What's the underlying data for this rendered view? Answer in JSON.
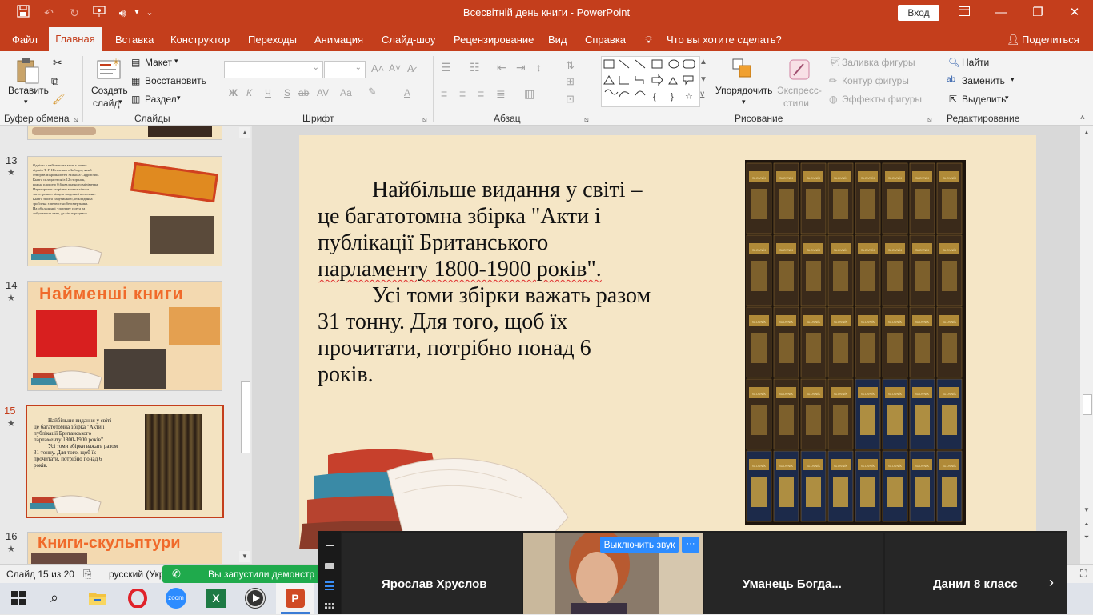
{
  "titlebar": {
    "title": "Всесвітній день книги  -  PowerPoint",
    "login": "Вход",
    "icons": [
      "save-icon",
      "undo-icon",
      "redo-icon",
      "slideshow-icon",
      "sound-icon",
      "customize-icon"
    ]
  },
  "menu": {
    "items": [
      "Файл",
      "Главная",
      "Вставка",
      "Конструктор",
      "Переходы",
      "Анимация",
      "Слайд-шоу",
      "Рецензирование",
      "Вид",
      "Справка",
      "Что вы хотите сделать?",
      "Поделиться"
    ]
  },
  "ribbon": {
    "clipboard": {
      "paste": "Вставить",
      "label": "Буфер обмена"
    },
    "slides": {
      "create_line1": "Создать",
      "create_line2": "слайд",
      "layout": "Макет",
      "reset": "Восстановить",
      "section": "Раздел",
      "label": "Слайды"
    },
    "font": {
      "label": "Шрифт",
      "buttons": [
        "Ж",
        "К",
        "Ч",
        "S",
        "ab",
        "AV",
        "Аа",
        "A"
      ]
    },
    "paragraph": {
      "label": "Абзац"
    },
    "drawing": {
      "arrange": "Упорядочить",
      "quick_line1": "Экспресс-",
      "quick_line2": "стили",
      "fill": "Заливка фигуры",
      "outline": "Контур фигуры",
      "effects": "Эффекты фигуры",
      "label": "Рисование"
    },
    "editing": {
      "find": "Найти",
      "replace": "Заменить",
      "select": "Выделить",
      "label": "Редактирование"
    }
  },
  "thumbnails": [
    {
      "num": "13",
      "star": "★",
      "lines": [
        "Однією з найменших книг є томик",
        "віршів Т. Г. Шевченка «Кобзар», який",
        "створив мікромайстер Микола Сядристий.",
        "Книга складається із 12 сторінок,",
        "кожна площею 0,6 квадратного міліметра.",
        "Перегортати сторінки можна тільки",
        "загостреною кінцем людської волосини.",
        "Книга зшита павутинкою, обкладинка",
        "зроблена з пелюстки безсмертника.",
        "На обкладинці - портрет поета та",
        "зображення хати, де він народився."
      ]
    },
    {
      "num": "14",
      "star": "★",
      "title": "Найменші книги"
    },
    {
      "num": "15",
      "star": "★",
      "lines": [
        "Найбільше видання у світі –",
        "це багатотомна збірка \"Акти і",
        "публікації Британського",
        "парламенту 1800-1900  років\".",
        "Усі томи збірки важать разом",
        "31 тонну. Для того, щоб їх",
        "прочитати,  потрібно понад 6",
        "років."
      ]
    },
    {
      "num": "16",
      "star": "★",
      "title": "Книги-скульптури"
    }
  ],
  "slide": {
    "paragraphs": [
      [
        "Найбільше видання у світі –",
        "це багатотомна збірка \"Акти і",
        "публікації Британського",
        "парламенту 1800-1900  років\"."
      ],
      [
        "Усі томи збірки важать разом",
        "31 тонну. Для того, щоб їх",
        "прочитати,  потрібно понад 6",
        "років."
      ]
    ],
    "spine_text_top": "SLOVNÍK",
    "spine_text_bottom": "OTTŮV SLOVNÍK NAUČNÝ"
  },
  "statusbar": {
    "slide_info": "Слайд 15 из 20",
    "language": "русский (Укр",
    "notification": "Вы запустили демонстр"
  },
  "zoom": {
    "participants": [
      "Ярослав Хруслов",
      "Уманець  Богда...",
      "Данил 8 класс"
    ],
    "mute_button": "Выключить звук",
    "more": "···"
  },
  "taskbar": {
    "apps": [
      "start-icon",
      "search-icon",
      "explorer-icon",
      "opera-icon",
      "zoom-icon",
      "excel-icon",
      "media-icon",
      "powerpoint-icon"
    ],
    "zoom_label": "zoom"
  }
}
